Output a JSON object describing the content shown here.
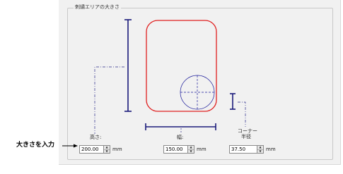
{
  "group_title": "刺繍エリアの大きさ",
  "callout_label": "大きさを入力",
  "fields": {
    "height": {
      "label": "高さ:",
      "value": "200.00",
      "unit": "mm"
    },
    "width": {
      "label": "幅:",
      "value": "150.00",
      "unit": "mm"
    },
    "corner_radius": {
      "label_line1": "コーナー",
      "label_line2": "半径",
      "value": "37.50",
      "unit": "mm"
    }
  },
  "spinner": {
    "up_glyph": "▲",
    "down_glyph": "▼"
  },
  "colors": {
    "hoop_outline": "#e02020",
    "dimension_line": "#1a1a7a",
    "guide_line": "#2a2a8a",
    "panel_bg": "#f1f1f1"
  }
}
